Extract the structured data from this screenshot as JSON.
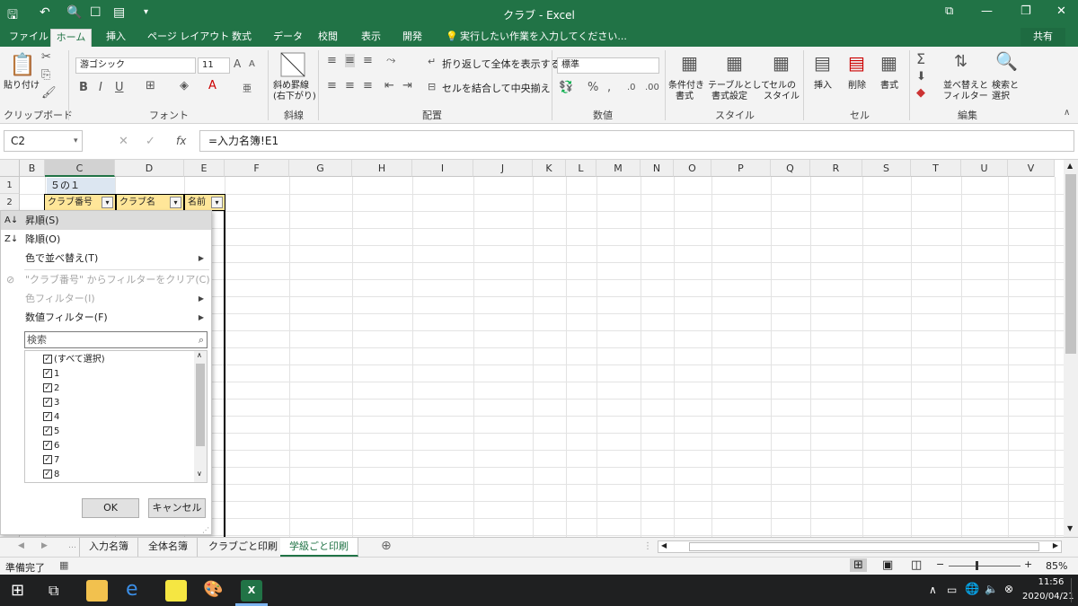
{
  "app": {
    "title": "クラブ - Excel"
  },
  "tabs": [
    "ファイル",
    "ホーム",
    "挿入",
    "ページ レイアウト",
    "数式",
    "データ",
    "校閲",
    "表示",
    "開発"
  ],
  "tell_me": "実行したい作業を入力してください...",
  "share": "共有",
  "ribbon": {
    "paste": "貼り付け",
    "clipboard": "クリップボード",
    "font_name": "游ゴシック",
    "font_size": "11",
    "font_group": "フォント",
    "diag_border": "斜め罫線",
    "diag_border2": "(右下がり)",
    "diag_group": "斜線",
    "wrap": "折り返して全体を表示する",
    "merge": "セルを結合して中央揃え",
    "align_group": "配置",
    "number_format": "標準",
    "number_group": "数値",
    "cond_format": "条件付き",
    "cond_format2": "書式",
    "table_format": "テーブルとして",
    "table_format2": "書式設定",
    "cell_style": "セルの",
    "cell_style2": "スタイル",
    "style_group": "スタイル",
    "insert": "挿入",
    "delete": "削除",
    "format": "書式",
    "cells_group": "セル",
    "sort": "並べ替えと",
    "sort2": "フィルター",
    "find": "検索と",
    "find2": "選択",
    "edit_group": "編集"
  },
  "formula": {
    "name_box": "C2",
    "content": "=入力名簿!E1"
  },
  "columns": [
    "B",
    "C",
    "D",
    "E",
    "F",
    "G",
    "H",
    "I",
    "J",
    "K",
    "L",
    "M",
    "N",
    "O",
    "P",
    "Q",
    "R",
    "S",
    "T",
    "U",
    "V"
  ],
  "rows": [
    "1",
    "2"
  ],
  "cells": {
    "c1": "５の１",
    "c2": "クラブ番号",
    "d2": "クラブ名",
    "e2": "名前"
  },
  "filter_menu": {
    "sort_asc": "昇順(S)",
    "sort_desc": "降順(O)",
    "sort_color": "色で並べ替え(T)",
    "clear": "\"クラブ番号\" からフィルターをクリア(C)",
    "color_filter": "色フィルター(I)",
    "number_filter": "数値フィルター(F)",
    "search_placeholder": "検索",
    "items": [
      "(すべて選択)",
      "1",
      "2",
      "3",
      "4",
      "5",
      "6",
      "7",
      "8"
    ],
    "ok": "OK",
    "cancel": "キャンセル"
  },
  "sheets": [
    "入力名簿",
    "全体名簿",
    "クラブごと印刷",
    "学級ごと印刷"
  ],
  "active_sheet": "学級ごと印刷",
  "status": {
    "ready": "準備完了",
    "zoom": "85%"
  },
  "clock": {
    "time": "11:56",
    "date": "2020/04/21"
  },
  "colors": {
    "excel_green": "#217346",
    "header_fill": "#ffe699"
  }
}
